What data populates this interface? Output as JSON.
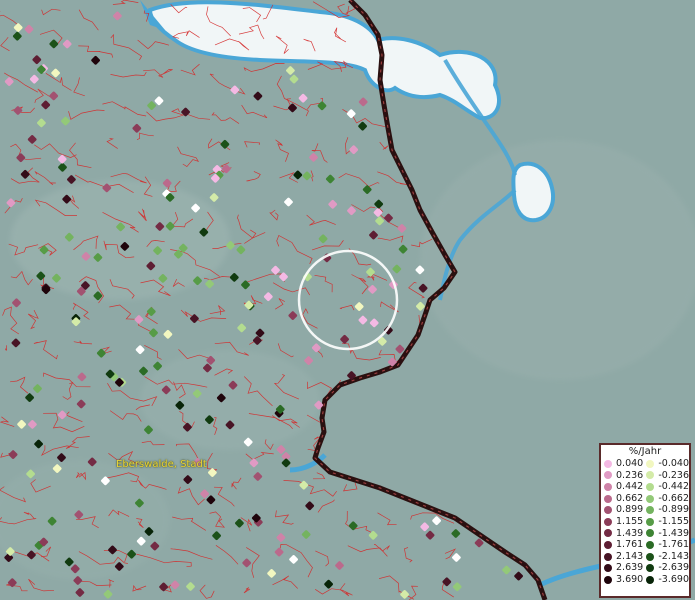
{
  "map": {
    "place_label": "Eberswalde, Stadt",
    "colors": {
      "background": "#8fa9a6",
      "water": "#f1f6f7",
      "water_edge": "#4aa6d6",
      "boundary": "#d42a2a",
      "border_line": "#2a1010",
      "highlight_circle": "#ffffff"
    }
  },
  "legend": {
    "title": "%/Jahr",
    "positive": [
      {
        "value": "0.040",
        "color": "#f4b9e4"
      },
      {
        "value": "0.236",
        "color": "#e09ac4"
      },
      {
        "value": "0.442",
        "color": "#cf83a8"
      },
      {
        "value": "0.662",
        "color": "#bb6a8c"
      },
      {
        "value": "0.899",
        "color": "#a25271"
      },
      {
        "value": "1.155",
        "color": "#8b3c58"
      },
      {
        "value": "1.439",
        "color": "#742b44"
      },
      {
        "value": "1.761",
        "color": "#5e1e33"
      },
      {
        "value": "2.143",
        "color": "#481425"
      },
      {
        "value": "2.639",
        "color": "#330b18"
      },
      {
        "value": "3.690",
        "color": "#1f040b"
      }
    ],
    "negative": [
      {
        "value": "-0.040",
        "color": "#f2f7c0"
      },
      {
        "value": "-0.236",
        "color": "#d4eba8"
      },
      {
        "value": "-0.442",
        "color": "#b3dc8f"
      },
      {
        "value": "-0.662",
        "color": "#93c978"
      },
      {
        "value": "-0.899",
        "color": "#74b35f"
      },
      {
        "value": "-1.155",
        "color": "#579c47"
      },
      {
        "value": "-1.439",
        "color": "#3e8434"
      },
      {
        "value": "-1.761",
        "color": "#2b6b25"
      },
      {
        "value": "-2.143",
        "color": "#1c5219"
      },
      {
        "value": "-2.639",
        "color": "#113b10"
      },
      {
        "value": "-3.690",
        "color": "#082408"
      }
    ]
  }
}
